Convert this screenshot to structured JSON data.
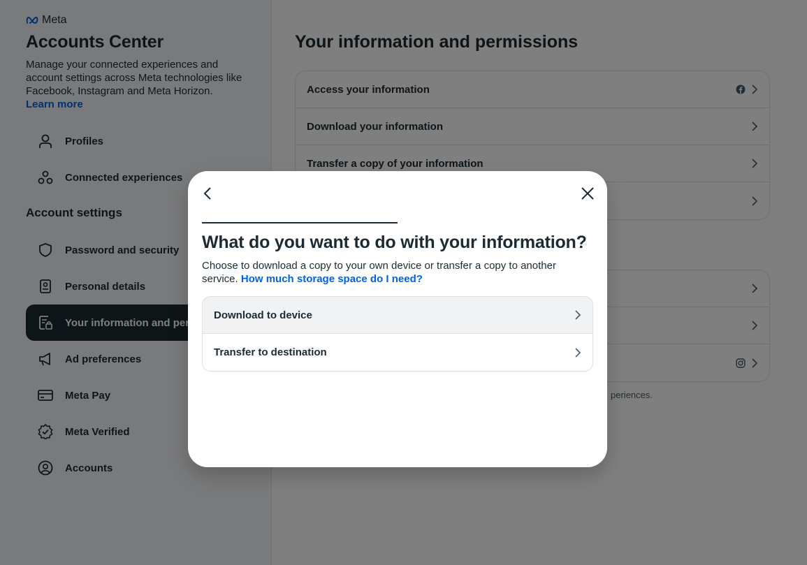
{
  "brand": {
    "name": "Meta"
  },
  "sidebar": {
    "title": "Accounts Center",
    "description": "Manage your connected experiences and account settings across Meta technologies like Facebook, Instagram and Meta Horizon.",
    "learn_more": "Learn more",
    "top_items": [
      {
        "label": "Profiles",
        "icon": "person-icon"
      },
      {
        "label": "Connected experiences",
        "icon": "connected-icon"
      }
    ],
    "section_heading": "Account settings",
    "settings_items": [
      {
        "label": "Password and security",
        "icon": "shield-icon"
      },
      {
        "label": "Personal details",
        "icon": "id-card-icon"
      },
      {
        "label": "Your information and permissions",
        "icon": "info-lock-icon",
        "active": true
      },
      {
        "label": "Ad preferences",
        "icon": "megaphone-icon"
      },
      {
        "label": "Meta Pay",
        "icon": "card-icon"
      },
      {
        "label": "Meta Verified",
        "icon": "verified-badge-icon"
      },
      {
        "label": "Accounts",
        "icon": "account-circle-icon"
      }
    ]
  },
  "main": {
    "title": "Your information and permissions",
    "card1_rows": [
      {
        "label": "Access your information",
        "badge": "facebook-icon"
      },
      {
        "label": "Download your information"
      },
      {
        "label": "Transfer a copy of your information"
      },
      {
        "label": ""
      }
    ],
    "card2_rows": [
      {
        "label": ""
      },
      {
        "label": ""
      },
      {
        "label": "",
        "badge": "instagram-icon"
      }
    ],
    "footnote": "periences."
  },
  "modal": {
    "title": "What do you want to do with your information?",
    "description": "Choose to download a copy to your own device or transfer a copy to another service.",
    "help_link": "How much storage space do I need?",
    "options": [
      {
        "label": "Download to device"
      },
      {
        "label": "Transfer to destination"
      }
    ]
  },
  "colors": {
    "text": "#1c2b33",
    "link": "#0064e0",
    "active_nav_bg": "#1c2b33",
    "border": "#dde1e5"
  }
}
